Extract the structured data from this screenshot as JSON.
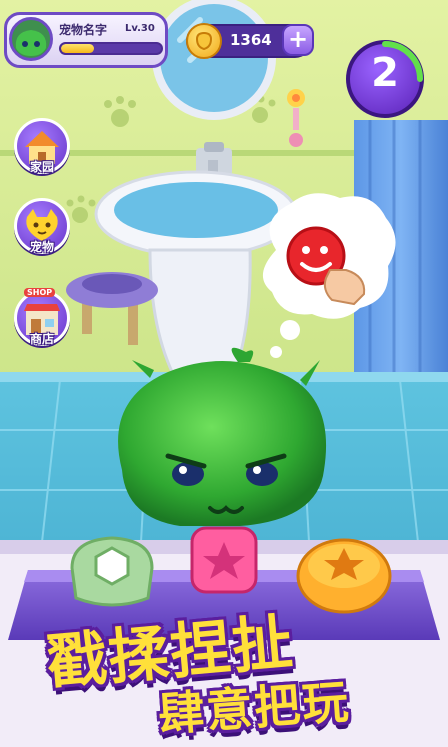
{
  "hud": {
    "pet_name": "宠物名字",
    "level": "Lv.30",
    "xp_fraction": 0.33,
    "coins": "1364",
    "add_coins_symbol": "+",
    "counter": "2"
  },
  "menu": {
    "items": [
      {
        "label": "家园",
        "icon": "house-icon"
      },
      {
        "label": "宠物",
        "icon": "pet-cat-icon"
      },
      {
        "label": "商店",
        "icon": "shop-icon",
        "badge": "SHOP"
      }
    ]
  },
  "slogan": {
    "line1": "戳揉捏扯",
    "line2": "肆意把玩"
  },
  "colors": {
    "accent_purple": "#6e4bc4",
    "coin_gold": "#f2a91a",
    "slogan_yellow": "#ffe03a",
    "slime_green": "#37b43a",
    "tile_blue": "#4fb7d8"
  }
}
